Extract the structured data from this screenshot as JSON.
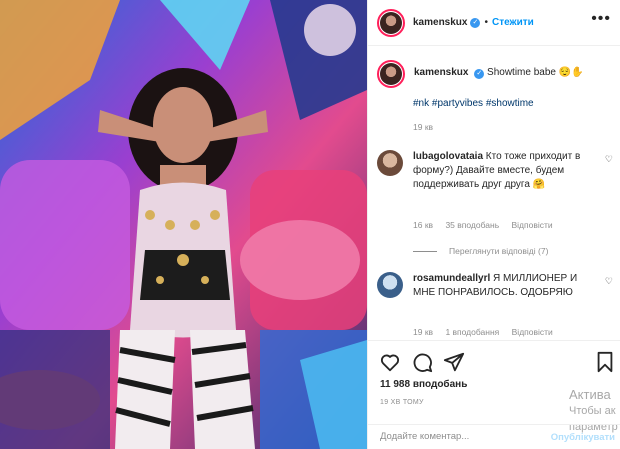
{
  "header": {
    "username": "kamenskux",
    "separator": "•",
    "follow_label": "Стежити",
    "more_label": "•••"
  },
  "caption": {
    "username": "kamenskux",
    "text": "Showtime babe 😌✋",
    "hashtags": "#nk #partyvibes #showtime",
    "time": "19 кв"
  },
  "comments": [
    {
      "username": "lubagolovataia",
      "text": "Кто тоже приходит в форму?) Давайте вместе, будем поддерживать друг друга 🤗",
      "time": "16 кв",
      "likes": "35 вподобань",
      "reply": "Відповісти",
      "view_replies": "Переглянути відповіді (7)"
    },
    {
      "username": "rosamundeallyrl",
      "text": "Я МИЛЛИОНЕР И МНЕ ПОНРАВИЛОСЬ. ОДОБРЯЮ",
      "time": "19 кв",
      "likes": "1 вподобання",
      "reply": "Відповісти"
    }
  ],
  "likes_count": "11 988 вподобань",
  "posted": "19 ХВ ТОМУ",
  "composer": {
    "placeholder": "Додайте коментар...",
    "publish_label": "Опублікувати"
  },
  "watermark": {
    "line1": "Актива",
    "line2": "Чтобы ак",
    "line3": "параметр"
  },
  "colors": {
    "link_blue": "#0095f6",
    "hashtag_blue": "#00376b",
    "muted": "#8e8e8e",
    "verified": "#3897f0"
  },
  "icons": [
    "verified-badge-icon",
    "more-options-icon",
    "heart-icon",
    "comment-icon",
    "share-icon",
    "bookmark-icon"
  ]
}
